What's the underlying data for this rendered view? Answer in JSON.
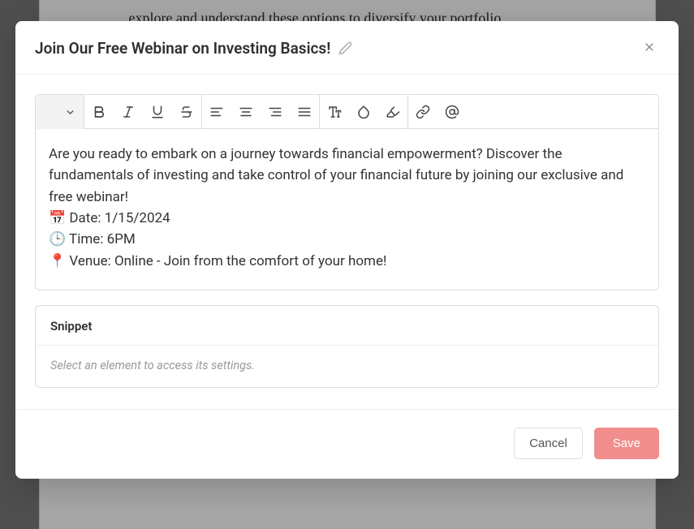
{
  "background": {
    "visible_text": "explore and understand these options to diversify your portfolio"
  },
  "modal": {
    "title": "Join Our Free Webinar on Investing Basics!",
    "editor": {
      "intro": "Are you ready to embark on a journey towards financial empowerment? Discover the fundamentals of investing and take control of your financial future by joining our exclusive and free webinar!",
      "date_line": "📅 Date: 1/15/2024",
      "time_line": "🕒 Time: 6PM",
      "venue_line": "📍 Venue: Online - Join from the comfort of your home!"
    },
    "snippet": {
      "header": "Snippet",
      "placeholder": "Select an element to access its settings."
    },
    "buttons": {
      "cancel": "Cancel",
      "save": "Save"
    }
  }
}
